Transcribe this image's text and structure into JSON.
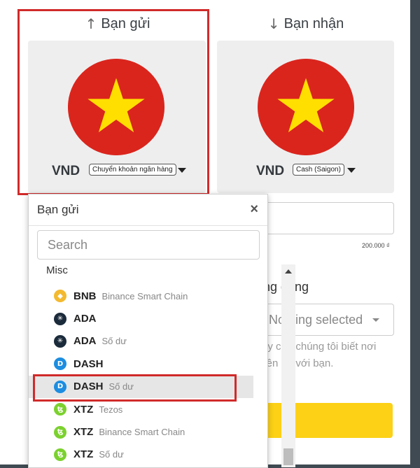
{
  "send": {
    "heading": "Bạn gửi",
    "arrow": "↑",
    "currency": "VND",
    "method": "Chuyển khoản ngân hàng"
  },
  "receive": {
    "heading": "Bạn nhận",
    "arrow": "↓",
    "currency": "VND",
    "method": "Cash (Saigon)"
  },
  "colors": {
    "flag_red": "#da251d",
    "flag_star": "#ffdf00",
    "highlight": "#d12a2a",
    "submit": "#fcd116"
  },
  "form": {
    "amount_note": "200.000 ₫",
    "app_label": "ng dụng",
    "app_select_placeholder": "Nothing selected",
    "help_line1": "ay cho chúng tôi biết nơi",
    "help_line2": "liên hệ với bạn."
  },
  "dropdown": {
    "title": "Bạn gửi",
    "close": "×",
    "search_placeholder": "Search",
    "group": "Misc",
    "items": [
      {
        "symbol": "BNB",
        "network": "Binance Smart Chain",
        "icon": "bnb-icon",
        "color": "#f3ba2f",
        "glyph": "◆",
        "active": false
      },
      {
        "symbol": "ADA",
        "network": "",
        "icon": "ada-icon",
        "color": "#1b2b3b",
        "glyph": "✳",
        "active": false
      },
      {
        "symbol": "ADA",
        "network": "Số dư",
        "icon": "ada-icon",
        "color": "#1b2b3b",
        "glyph": "✳",
        "active": false
      },
      {
        "symbol": "DASH",
        "network": "",
        "icon": "dash-icon",
        "color": "#1c8de0",
        "glyph": "D",
        "active": false
      },
      {
        "symbol": "DASH",
        "network": "Số dư",
        "icon": "dash-icon",
        "color": "#1c8de0",
        "glyph": "D",
        "active": true
      },
      {
        "symbol": "XTZ",
        "network": "Tezos",
        "icon": "tezos-icon",
        "color": "#7bd12e",
        "glyph": "ꜩ",
        "active": false
      },
      {
        "symbol": "XTZ",
        "network": "Binance Smart Chain",
        "icon": "tezos-icon",
        "color": "#7bd12e",
        "glyph": "ꜩ",
        "active": false
      },
      {
        "symbol": "XTZ",
        "network": "Số dư",
        "icon": "tezos-icon",
        "color": "#7bd12e",
        "glyph": "ꜩ",
        "active": false
      }
    ]
  }
}
